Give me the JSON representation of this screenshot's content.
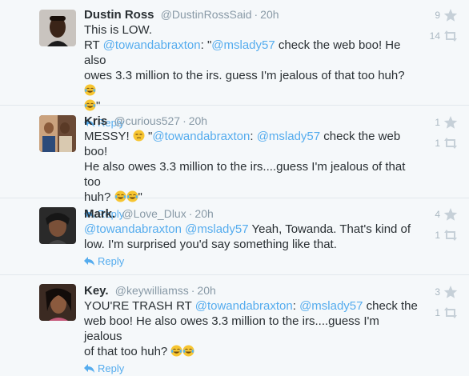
{
  "tweets": [
    {
      "name": "Dustin Ross",
      "handle": "@DustinRossSaid",
      "time": "20h",
      "lines": [
        [
          {
            "t": "This is LOW."
          }
        ],
        [
          {
            "t": "RT "
          },
          {
            "t": "@towandabraxton",
            "m": true
          },
          {
            "t": ": \""
          },
          {
            "t": "@mslady57",
            "m": true
          },
          {
            "t": " check the web boo! He also"
          }
        ],
        [
          {
            "t": "owes 3.3 million to the irs. guess I'm jealous of that too huh? "
          },
          {
            "e": "joy"
          }
        ],
        [
          {
            "e": "joy"
          },
          {
            "t": "\""
          }
        ]
      ],
      "reply": "Reply",
      "favorites": "9",
      "retweets": "14"
    },
    {
      "name": "Kris",
      "handle": "@curious527",
      "time": "20h",
      "lines": [
        [
          {
            "t": "MESSY! "
          },
          {
            "e": "unamused"
          },
          {
            "t": " \""
          },
          {
            "t": "@towandabraxton",
            "m": true
          },
          {
            "t": ": "
          },
          {
            "t": "@mslady57",
            "m": true
          },
          {
            "t": " check the web boo!"
          }
        ],
        [
          {
            "t": "He also owes 3.3 million to the irs....guess I'm jealous of that too"
          }
        ],
        [
          {
            "t": "huh? "
          },
          {
            "e": "joy"
          },
          {
            "e": "joy"
          },
          {
            "t": "\""
          }
        ]
      ],
      "reply": "Reply",
      "favorites": "1",
      "retweets": "1"
    },
    {
      "name": "Mark.",
      "handle": "@Love_Dlux",
      "time": "20h",
      "lines": [
        [
          {
            "t": "@towandabraxton",
            "m": true
          },
          {
            "t": " "
          },
          {
            "t": "@mslady57",
            "m": true
          },
          {
            "t": " Yeah, Towanda. That's kind of"
          }
        ],
        [
          {
            "t": "low. I'm surprised you'd say something like that."
          }
        ]
      ],
      "reply": "Reply",
      "favorites": "4",
      "retweets": "1"
    },
    {
      "name": "Key.",
      "handle": "@keywilliamss",
      "time": "20h",
      "lines": [
        [
          {
            "t": "YOU'RE TRASH RT "
          },
          {
            "t": "@towandabraxton",
            "m": true
          },
          {
            "t": ": "
          },
          {
            "t": "@mslady57",
            "m": true
          },
          {
            "t": " check the"
          }
        ],
        [
          {
            "t": "web boo! He also owes 3.3 million to the irs....guess I'm jealous"
          }
        ],
        [
          {
            "t": "of that too huh? "
          },
          {
            "e": "joy"
          },
          {
            "e": "joy"
          }
        ]
      ],
      "reply": "Reply",
      "favorites": "3",
      "retweets": "1"
    }
  ],
  "icons": {
    "favorite": "star-icon",
    "retweet": "retweet-icon",
    "reply": "reply-arrow-icon"
  },
  "colors": {
    "link": "#55acee",
    "muted": "#8899a6",
    "stat": "#aab8c2"
  }
}
